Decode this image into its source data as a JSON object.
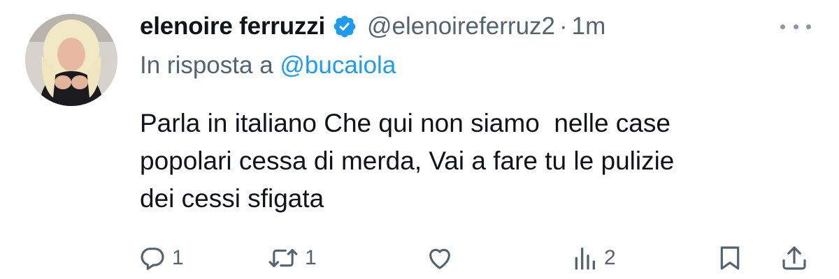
{
  "tweet": {
    "display_name": "elenoire ferruzzi",
    "handle": "@elenoireferruz2",
    "separator": "·",
    "time": "1m",
    "reply_prefix": "In risposta a",
    "reply_to": "@bucaiola",
    "text_lines": [
      "Parla in italiano Che qui non siamo  nelle case",
      "popolari cessa di merda, Vai a fare tu le pulizie",
      "dei cessi sfigata"
    ]
  },
  "actions": {
    "replies": "1",
    "reposts": "1",
    "likes": "",
    "views": "2"
  },
  "colors": {
    "text_primary": "#0f1419",
    "text_secondary": "#536471",
    "mention_blue": "#1d9bf0",
    "verified_blue": "#1d9bf0"
  },
  "icons": {
    "verified": "verified-badge-icon",
    "more": "more-dots-icon",
    "reply": "reply-bubble-icon",
    "repost": "repost-arrows-icon",
    "like": "heart-icon",
    "views": "views-bars-icon",
    "bookmark": "bookmark-icon",
    "share": "share-upload-icon"
  }
}
